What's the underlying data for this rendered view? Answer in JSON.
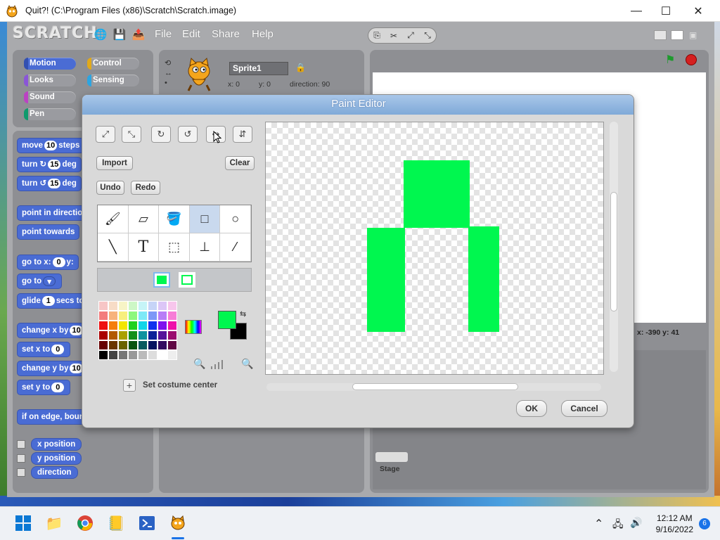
{
  "window": {
    "title": "Quit?! (C:\\Program Files (x86)\\Scratch\\Scratch.image)",
    "controls": [
      "—",
      "☐",
      "✕"
    ]
  },
  "scratch": {
    "logo": "SCRATCH",
    "menu": [
      "File",
      "Edit",
      "Share",
      "Help"
    ],
    "categories": [
      {
        "label": "Motion",
        "color": "#4a6cd4"
      },
      {
        "label": "Control",
        "color": "#e1a91a"
      },
      {
        "label": "Looks",
        "color": "#8a55d7"
      },
      {
        "label": "Sensing",
        "color": "#2ca5e2"
      },
      {
        "label": "Sound",
        "color": "#bb42c3"
      },
      {
        "label": "Pen",
        "color": "#0e9a6c"
      }
    ],
    "blocks": [
      {
        "pre": "move",
        "slot": "10",
        "post": "steps"
      },
      {
        "pre": "turn ↻",
        "slot": "15",
        "post": "deg"
      },
      {
        "pre": "turn ↺",
        "slot": "15",
        "post": "deg"
      },
      {
        "pre": "point in directio",
        "slot": "",
        "post": ""
      },
      {
        "pre": "point towards",
        "slot": "",
        "post": ""
      },
      {
        "pre": "go to x:",
        "slot": "0",
        "post": "y:"
      },
      {
        "pre": "go to",
        "slot": "▾",
        "post": ""
      },
      {
        "pre": "glide",
        "slot": "1",
        "post": "secs to"
      },
      {
        "pre": "change x by",
        "slot": "10",
        "post": ""
      },
      {
        "pre": "set x to",
        "slot": "0",
        "post": ""
      },
      {
        "pre": "change y by",
        "slot": "10",
        "post": ""
      },
      {
        "pre": "set y to",
        "slot": "0",
        "post": ""
      },
      {
        "pre": "if on edge, boun",
        "slot": "",
        "post": ""
      }
    ],
    "reporters": [
      "x position",
      "y position",
      "direction"
    ],
    "sprite": {
      "name": "Sprite1",
      "x_label": "x: 0",
      "y_label": "y: 0",
      "direction_label": "direction: 90"
    },
    "stage": {
      "coords": "x: -390   y: 41",
      "label": "Stage"
    }
  },
  "paint_editor": {
    "title": "Paint Editor",
    "import_label": "Import",
    "clear_label": "Clear",
    "undo_label": "Undo",
    "redo_label": "Redo",
    "set_center_label": "Set costume center",
    "ok_label": "OK",
    "cancel_label": "Cancel",
    "fill_color": "#00f74f",
    "palette": [
      "#f7c6c6",
      "#f7dcc6",
      "#f7f4c6",
      "#cdf7c6",
      "#c6f4f7",
      "#c6d4f7",
      "#dcc6f7",
      "#f7c6ec",
      "#f37d7d",
      "#f7b37d",
      "#f7ef7d",
      "#8df77d",
      "#7de9f7",
      "#7d98f7",
      "#b87df7",
      "#f77dd7",
      "#ee1111",
      "#f57e0b",
      "#f3e500",
      "#1fd11f",
      "#11d5e8",
      "#1133ee",
      "#7f11ee",
      "#ee11aa",
      "#aa0000",
      "#b25a00",
      "#aaa000",
      "#12901a",
      "#0d929f",
      "#0b2199",
      "#55119a",
      "#9a0b6f",
      "#660000",
      "#6a3600",
      "#6a6300",
      "#0b5511",
      "#085a60",
      "#061460",
      "#330a60",
      "#600744",
      "#000000",
      "#444444",
      "#777777",
      "#999999",
      "#bbbbbb",
      "#dddddd",
      "#ffffff",
      "#eeeeee"
    ]
  },
  "taskbar": {
    "time": "12:12 AM",
    "date": "9/16/2022",
    "notifications": "6"
  }
}
